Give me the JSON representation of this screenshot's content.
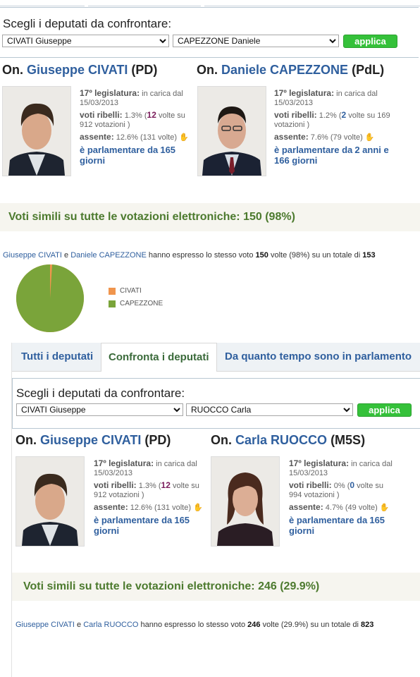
{
  "colors": {
    "link": "#2f5f9e",
    "apply": "#35c13a",
    "civati": "#f0954d",
    "capezzone": "#7aa43a",
    "similar": "#4c7a2e"
  },
  "top": {
    "picker": {
      "label": "Scegli i deputati da confrontare:",
      "select1": "CIVATI Giuseppe",
      "select2": "CAPEZZONE Daniele",
      "apply": "applica"
    },
    "mp1": {
      "prefix": "On.",
      "name": "Giuseppe CIVATI",
      "party": "(PD)",
      "leg_label": "17º legislatura:",
      "leg_val": "in carica dal 15/03/2013",
      "rebel_label": "voti ribelli:",
      "rebel_pct": "1.3% (",
      "rebel_n": "12",
      "rebel_rest": "volte su 912 votazioni )",
      "absent_label": "assente:",
      "absent_val": "12.6% (131 volte)",
      "tenure_label": "è parlamentare da",
      "tenure_val": "165 giorni"
    },
    "mp2": {
      "prefix": "On.",
      "name": "Daniele CAPEZZONE",
      "party": "(PdL)",
      "leg_label": "17º legislatura:",
      "leg_val": "in carica dal 15/03/2013",
      "rebel_label": "voti ribelli:",
      "rebel_pct": "1.2% (",
      "rebel_n": "2",
      "rebel_rest": "volte su 169 votazioni )",
      "absent_label": "assente:",
      "absent_val": "7.6% (79 volte)",
      "tenure_label": "è parlamentare da",
      "tenure_val": "2 anni e 166 giorni"
    },
    "similar": "Voti simili su tutte le votazioni elettroniche: 150 (98%)",
    "summary": {
      "a": "Giuseppe CIVATI",
      "and": "e",
      "b": "Daniele CAPEZZONE",
      "mid": "hanno espresso lo stesso voto",
      "n": "150",
      "rest": "volte (98%) su un totale di",
      "tot": "153"
    },
    "legend": [
      "CIVATI",
      "CAPEZZONE"
    ],
    "pie": {
      "civati_share": 0.01,
      "capezzone_share": 0.99
    }
  },
  "tabs": [
    "Tutti i deputati",
    "Confronta i deputati",
    "Da quanto tempo sono in parlamento"
  ],
  "bottom": {
    "picker": {
      "label": "Scegli i deputati da confrontare:",
      "select1": "CIVATI Giuseppe",
      "select2": "RUOCCO Carla",
      "apply": "applica"
    },
    "mp1": {
      "prefix": "On.",
      "name": "Giuseppe CIVATI",
      "party": "(PD)",
      "leg_label": "17º legislatura:",
      "leg_val": "in carica dal 15/03/2013",
      "rebel_label": "voti ribelli:",
      "rebel_pct": "1.3% (",
      "rebel_n": "12",
      "rebel_rest": "volte su 912 votazioni )",
      "absent_label": "assente:",
      "absent_val": "12.6% (131 volte)",
      "tenure_label": "è parlamentare da",
      "tenure_val": "165 giorni"
    },
    "mp2": {
      "prefix": "On.",
      "name": "Carla RUOCCO",
      "party": "(M5S)",
      "leg_label": "17º legislatura:",
      "leg_val": "in carica dal 15/03/2013",
      "rebel_label": "voti ribelli:",
      "rebel_pct": "0% (",
      "rebel_n": "0",
      "rebel_rest": "volte su 994 votazioni )",
      "absent_label": "assente:",
      "absent_val": "4.7% (49 volte)",
      "tenure_label": "è parlamentare da",
      "tenure_val": "165 giorni"
    },
    "similar": "Voti simili su tutte le votazioni elettroniche: 246 (29.9%)",
    "summary": {
      "a": "Giuseppe CIVATI",
      "and": "e",
      "b": "Carla RUOCCO",
      "mid": "hanno espresso lo stesso voto",
      "n": "246",
      "rest": "volte (29.9%) su un totale di",
      "tot": "823"
    }
  }
}
